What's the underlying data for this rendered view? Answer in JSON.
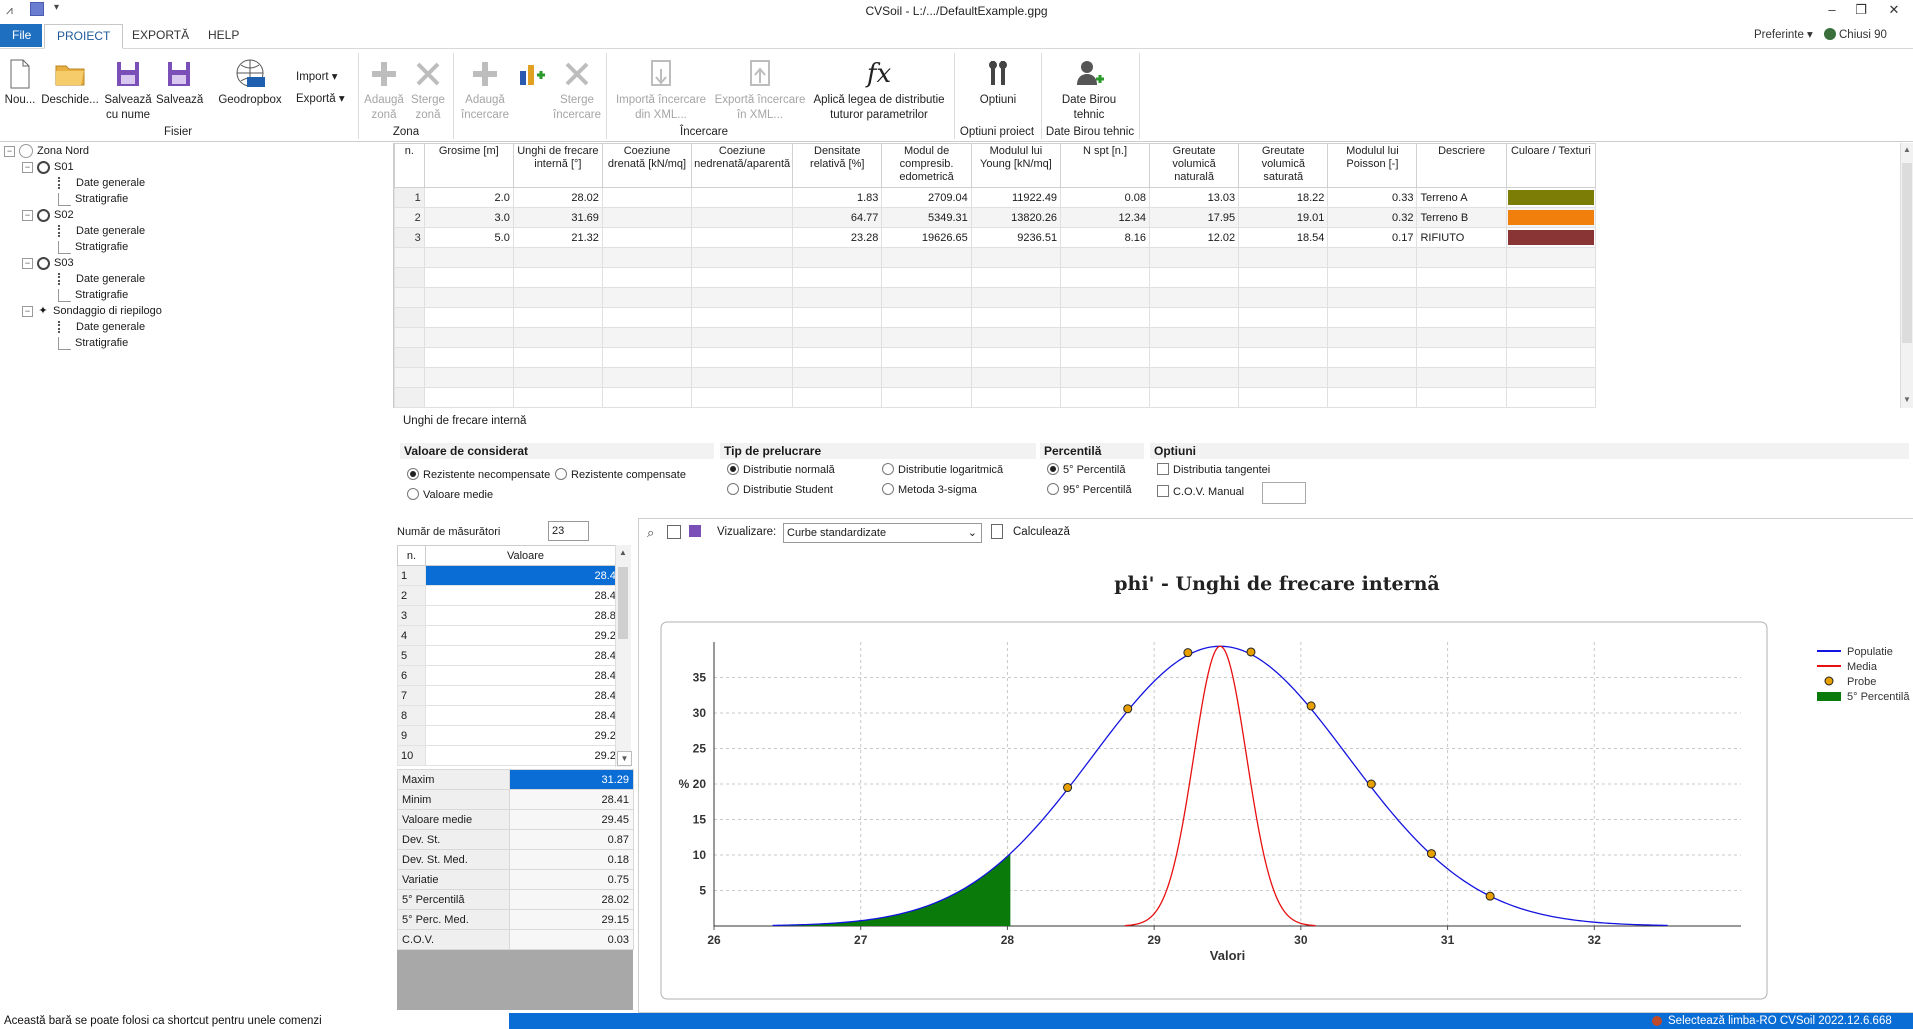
{
  "window": {
    "title": "CVSoil - L:/.../DefaultExample.gpg"
  },
  "menu": {
    "file": "File",
    "tabs": [
      "PROIECT",
      "EXPORTĂ",
      "HELP"
    ],
    "prefs": "Preferinte",
    "user": "Chiusi 90"
  },
  "ribbon": {
    "fisier": [
      "Nou...",
      "Deschide...",
      "Salvează cu nume",
      "Salvează",
      "Geodropbox"
    ],
    "import": "Import",
    "export": "Exportă",
    "fisier_group": "Fisier",
    "zona": [
      "Adaugă zonă",
      "Sterge zonă"
    ],
    "zona_group": "Zona",
    "incercare": [
      "Adaugă încercare",
      "",
      "Sterge încercare",
      "Importă încercare din XML...",
      "Exportă încercare în XML...",
      "Aplică legea de distributie tuturor parametrilor"
    ],
    "incercare_group": "Încercare",
    "optiuni": "Optiuni",
    "optiuni_group": "Optiuni proiect",
    "birou": "Date Birou tehnic",
    "birou_group": "Date Birou tehnic"
  },
  "tree": {
    "root": "Zona Nord",
    "sites": [
      {
        "name": "S01",
        "children": [
          "Date generale",
          "Stratigrafie"
        ]
      },
      {
        "name": "S02",
        "children": [
          "Date generale",
          "Stratigrafie"
        ]
      },
      {
        "name": "S03",
        "children": [
          "Date generale",
          "Stratigrafie"
        ]
      },
      {
        "name": "Sondaggio di riepilogo",
        "children": [
          "Date generale",
          "Stratigrafie"
        ]
      }
    ]
  },
  "grid": {
    "headers": [
      "n.",
      "Grosime [m]",
      "Unghi de frecare internă [°]",
      "Coeziune drenată [kN/mq]",
      "Coeziune nedrenată/aparentă",
      "Densitate relativă [%]",
      "Modul de compresib. edometrică",
      "Modulul lui Young [kN/mq]",
      "N spt [n.]",
      "Greutate volumică naturală",
      "Greutate volumică saturată",
      "Modulul lui Poisson [-]",
      "Descriere",
      "Culoare / Texturi"
    ],
    "rows": [
      {
        "n": "1",
        "cells": [
          "2.0",
          "28.02",
          "",
          "",
          "1.83",
          "2709.04",
          "11922.49",
          "0.08",
          "13.03",
          "18.22",
          "0.33",
          "Terreno A"
        ],
        "color": "#7b7d06"
      },
      {
        "n": "2",
        "cells": [
          "3.0",
          "31.69",
          "",
          "",
          "64.77",
          "5349.31",
          "13820.26",
          "12.34",
          "17.95",
          "19.01",
          "0.32",
          "Terreno B"
        ],
        "color": "#f07f0b"
      },
      {
        "n": "3",
        "cells": [
          "5.0",
          "21.32",
          "",
          "",
          "23.28",
          "19626.65",
          "9236.51",
          "8.16",
          "12.02",
          "18.54",
          "0.17",
          "RIFIUTO"
        ],
        "color": "#8a3535"
      }
    ]
  },
  "field_label": "Unghi de frecare internă",
  "options": {
    "valoare_title": "Valoare de considerat",
    "valoare_opts": [
      "Rezistente necompensate",
      "Rezistente compensate",
      "Valoare medie"
    ],
    "prelucrare_title": "Tip de prelucrare",
    "prelucrare_opts": [
      "Distributie normală",
      "Distributie logaritmică",
      "Distributie Student",
      "Metoda 3-sigma"
    ],
    "percentila_title": "Percentilă",
    "percentila_opts": [
      "5° Percentilă",
      "95° Percentilă"
    ],
    "optiuni_title": "Optiuni",
    "optiuni_opts": [
      "Distributia tangentei",
      "C.O.V. Manual"
    ]
  },
  "measurements": {
    "count_label": "Număr de măsurători",
    "count": "23",
    "col_n": "n.",
    "col_v": "Valoare",
    "rows": [
      [
        "1",
        "28.41"
      ],
      [
        "2",
        "28.41"
      ],
      [
        "3",
        "28.82"
      ],
      [
        "4",
        "29.23"
      ],
      [
        "5",
        "28.41"
      ],
      [
        "6",
        "28.41"
      ],
      [
        "7",
        "28.41"
      ],
      [
        "8",
        "28.41"
      ],
      [
        "9",
        "29.23"
      ],
      [
        "10",
        "29.23"
      ]
    ],
    "stats": [
      [
        "Maxim",
        "31.29"
      ],
      [
        "Minim",
        "28.41"
      ],
      [
        "Valoare medie",
        "29.45"
      ],
      [
        "Dev. St.",
        "0.87"
      ],
      [
        "Dev. St. Med.",
        "0.18"
      ],
      [
        "Variatie",
        "0.75"
      ],
      [
        "5° Percentilă",
        "28.02"
      ],
      [
        "5° Perc. Med.",
        "29.15"
      ],
      [
        "C.O.V.",
        "0.03"
      ]
    ]
  },
  "chart_toolbar": {
    "viz_label": "Vizualizare:",
    "viz_value": "Curbe standardizate",
    "calc": "Calculează"
  },
  "chart_data": {
    "type": "line",
    "title": "phi' - Unghi de frecare internã",
    "xlabel": "Valori",
    "ylabel": "%",
    "xlim": [
      26,
      33
    ],
    "ylim": [
      0,
      40
    ],
    "xticks": [
      "26",
      "27",
      "28",
      "29",
      "30",
      "31",
      "32"
    ],
    "yticks": [
      "5",
      "10",
      "15",
      "20",
      "25",
      "30",
      "35"
    ],
    "grid": true,
    "legend_position": "right",
    "series": [
      {
        "name": "Populatie",
        "type": "line",
        "color": "#1414e0",
        "mean": 29.45,
        "sd": 0.87,
        "peak": 39.4
      },
      {
        "name": "Media",
        "type": "line",
        "color": "#e81010",
        "mean": 29.45,
        "sd": 0.18,
        "peak": 39.4
      },
      {
        "name": "Probe",
        "type": "scatter",
        "color": "#e8a000",
        "x": [
          28.41,
          28.82,
          29.23,
          29.66,
          30.07,
          30.48,
          30.89,
          31.29
        ],
        "y": [
          19.5,
          30.6,
          38.5,
          38.6,
          31.0,
          20.0,
          10.2,
          4.2
        ]
      },
      {
        "name": "5° Percentilă",
        "type": "area",
        "color": "#0a7a0a",
        "upto": 28.02
      }
    ]
  },
  "status": {
    "left": "Această bară se poate folosi ca shortcut pentru unele comenzi",
    "right": "Selectează limba-RO CVSoil 2022.12.6.668"
  }
}
